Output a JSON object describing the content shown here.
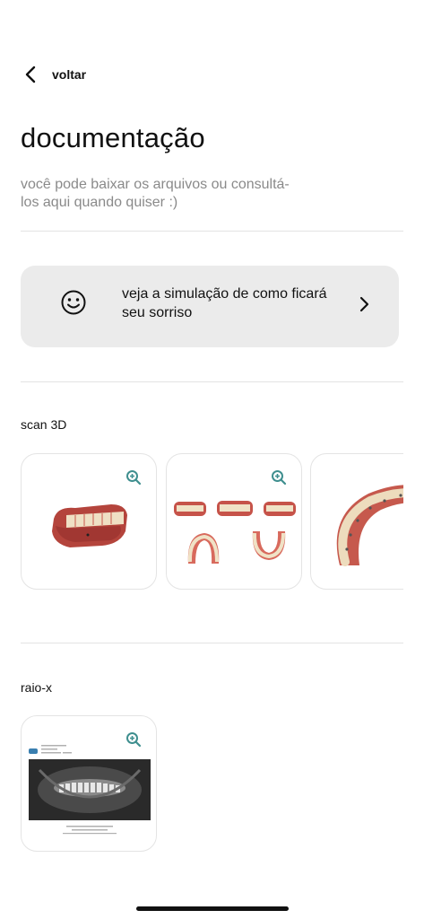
{
  "header": {
    "back_label": "voltar"
  },
  "page": {
    "title": "documentação",
    "subtitle": "você pode baixar os arquivos ou consultá-los aqui quando quiser :)"
  },
  "simulation_card": {
    "icon": "smile-icon",
    "label": "veja a simulação de como ficará seu sorriso",
    "chevron_icon": "chevron-right-icon"
  },
  "sections": {
    "scan3d": {
      "label": "scan 3D",
      "items": [
        {
          "image": "scan-3d-side-view",
          "zoom_icon": "zoom-in-icon"
        },
        {
          "image": "scan-3d-multi-view",
          "zoom_icon": "zoom-in-icon"
        },
        {
          "image": "scan-3d-arch-view",
          "zoom_icon": "zoom-in-icon"
        }
      ]
    },
    "xray": {
      "label": "raio-x",
      "items": [
        {
          "image": "panoramic-xray",
          "zoom_icon": "zoom-in-icon"
        }
      ]
    }
  },
  "colors": {
    "accent_icon": "#3f8f8f",
    "card_background": "#ebebeb",
    "subtitle_gray": "#8a8a8a",
    "tooth_pink": "#c9574d",
    "tooth_white": "#f1e5cc"
  }
}
